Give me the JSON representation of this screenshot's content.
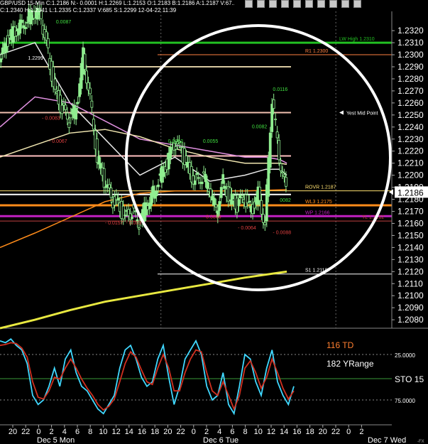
{
  "header": {
    "title": "GBP/USD 15-Min C:1.2186 N:- 0.0001 H:1.2269 L:1.2153 O:1.2183 B:1.2186 A:1.2187 V:67..",
    "line2": "C:1.2340 H:1.2341 L:1.2335 C:1.2337 V:685 S:1.2299 12-04-22 11:39"
  },
  "toolbar_icons": [
    "zoom-icon",
    "zoom-icon",
    "cursor-icon",
    "line-icon",
    "crosshair-icon",
    "text-icon",
    "pin-icon",
    "pencil-icon",
    "fib-icon",
    "magnet-icon"
  ],
  "colors": {
    "background": "#000000",
    "candle": "#90ee90",
    "green_line": "#22c022",
    "magenta_line": "#c020c0",
    "orange_line": "#ff8c1a",
    "yellow_line": "#e8e840",
    "pink_ma": "#e090e0",
    "white_ma": "#e8e8e8",
    "cream_ma": "#f0e6b0",
    "stoch_fast": "#40d8ff",
    "stoch_slow": "#d03020",
    "circle": "#ffffff"
  },
  "price_axis": {
    "labels": [
      "1.2320",
      "1.2310",
      "1.2300",
      "1.2290",
      "1.2280",
      "1.2270",
      "1.2260",
      "1.2250",
      "1.2240",
      "1.2230",
      "1.2220",
      "1.2210",
      "1.2200",
      "1.2190",
      "1.2180",
      "1.2170",
      "1.2160",
      "1.2150",
      "1.2140",
      "1.2130",
      "1.2120",
      "1.2110",
      "1.2100",
      "1.2090",
      "1.2080"
    ],
    "values": [
      1.232,
      1.231,
      1.23,
      1.229,
      1.228,
      1.227,
      1.226,
      1.225,
      1.224,
      1.223,
      1.222,
      1.221,
      1.22,
      1.219,
      1.218,
      1.217,
      1.216,
      1.215,
      1.214,
      1.213,
      1.212,
      1.211,
      1.21,
      1.209,
      1.208
    ],
    "current": "1.2186"
  },
  "levels": [
    {
      "label": "LW High 1.2310",
      "value": 1.231,
      "color": "#22c022",
      "kind": "bold"
    },
    {
      "label": "R1 1.2300",
      "value": 1.23,
      "color": "#ff8040",
      "kind": "thin"
    },
    {
      "label": "ROVR 1.2187",
      "value": 1.2187,
      "color": "#ffe070",
      "kind": "thin"
    },
    {
      "label": "WL3 1.2175",
      "value": 1.2175,
      "color": "#ff8c1a",
      "kind": "bold"
    },
    {
      "label": "WP 1.2166",
      "value": 1.2166,
      "color": "#c020c0",
      "kind": "bold"
    },
    {
      "label": "TL 1.2162",
      "value": 1.2162,
      "color": "#c04040",
      "kind": "thin"
    },
    {
      "label": "S1 1.2118",
      "value": 1.2118,
      "color": "#ffffff",
      "kind": "thin"
    }
  ],
  "annotations": {
    "yest_mid_point": "Yest Mid Point",
    "swing_labels": [
      "0.0087",
      "1.2299",
      "- 0.0083",
      "- 0.0067",
      "0.0052",
      "0.0055",
      "0.0082",
      "0.0116",
      "- 0.0157",
      "- 0.003",
      "- 0.0056",
      "- 0.0064",
      "- 0.0088",
      "0082"
    ]
  },
  "stochastic": {
    "td_label": "116 TD",
    "yrange_label": "182 YRange",
    "name": "STO 15",
    "levels": [
      "25.0000",
      "75.0000"
    ]
  },
  "time_axis": {
    "hours": [
      "20",
      "22",
      "0",
      "2",
      "4",
      "6",
      "8",
      "10",
      "12",
      "14",
      "16",
      "18",
      "20",
      "22",
      "0",
      "2",
      "4",
      "6",
      "8",
      "10",
      "12",
      "14",
      "16",
      "18",
      "20",
      "22",
      "0",
      "2"
    ],
    "days": [
      "Dec 5 Mon",
      "Dec 6 Tue",
      "Dec 7 Wed"
    ],
    "footer_mark": "-FX"
  },
  "chart_data": {
    "type": "line",
    "title": "GBP/USD 15-Min",
    "ylim": [
      1.2073,
      1.2336
    ],
    "xlim_hours_from_dec5_0000": [
      -5,
      51
    ],
    "series": [
      {
        "name": "GBP/USD",
        "x": [
          -5,
          -4,
          -3,
          -2,
          -1,
          0,
          1,
          2,
          3,
          4,
          5,
          6,
          7,
          8,
          9,
          10,
          11,
          12,
          13,
          14,
          15,
          16,
          17,
          18,
          19,
          20,
          21,
          22,
          23,
          24,
          25,
          26,
          27,
          28,
          29,
          30,
          31,
          32,
          33,
          34,
          35,
          36
        ],
        "values": [
          1.229,
          1.231,
          1.2318,
          1.2325,
          1.233,
          1.2336,
          1.233,
          1.23,
          1.2268,
          1.2255,
          1.2245,
          1.2255,
          1.23,
          1.2265,
          1.2215,
          1.2195,
          1.218,
          1.2175,
          1.2165,
          1.217,
          1.216,
          1.2175,
          1.2185,
          1.22,
          1.221,
          1.2225,
          1.222,
          1.2205,
          1.2195,
          1.22,
          1.219,
          1.217,
          1.2195,
          1.218,
          1.2175,
          1.218,
          1.217,
          1.2185,
          1.216,
          1.2265,
          1.2215,
          1.2186
        ]
      },
      {
        "name": "MA-white",
        "x": [
          -5,
          0,
          5,
          10,
          15,
          20,
          25,
          30,
          33,
          35,
          36
        ],
        "values": [
          1.23,
          1.231,
          1.226,
          1.223,
          1.22,
          1.2215,
          1.2195,
          1.22,
          1.2205,
          1.2205,
          1.22
        ]
      },
      {
        "name": "MA-pink",
        "x": [
          -5,
          0,
          5,
          10,
          15,
          20,
          25,
          30,
          33,
          35,
          36
        ],
        "values": [
          1.224,
          1.2265,
          1.226,
          1.2245,
          1.223,
          1.2225,
          1.222,
          1.2215,
          1.2215,
          1.2213,
          1.221
        ]
      },
      {
        "name": "MA-cream",
        "x": [
          -5,
          0,
          5,
          10,
          15,
          20,
          25,
          30,
          33,
          35,
          36
        ],
        "values": [
          1.2215,
          1.2225,
          1.2235,
          1.2238,
          1.2232,
          1.2222,
          1.2215,
          1.221,
          1.221,
          1.221,
          1.2209
        ]
      },
      {
        "name": "MA-orange",
        "x": [
          -5,
          0,
          5,
          10,
          15,
          20,
          25,
          30,
          36
        ],
        "values": [
          1.214,
          1.2152,
          1.2165,
          1.2178,
          1.2185,
          1.2187,
          1.2187,
          1.2187,
          1.2188
        ]
      },
      {
        "name": "MA-yellow",
        "x": [
          -5,
          0,
          5,
          10,
          15,
          20,
          25,
          30,
          36
        ],
        "values": [
          1.2073,
          1.208,
          1.2088,
          1.2095,
          1.21,
          1.2105,
          1.211,
          1.2115,
          1.212
        ]
      }
    ],
    "stoch_series": [
      {
        "name": "fast",
        "values": [
          10,
          12,
          8,
          15,
          20,
          35,
          70,
          80,
          75,
          60,
          40,
          60,
          30,
          20,
          45,
          60,
          65,
          75,
          85,
          90,
          80,
          70,
          40,
          20,
          15,
          30,
          50,
          60,
          55,
          30,
          15,
          50,
          80,
          60,
          30,
          20,
          10,
          25,
          60,
          75,
          70,
          45,
          80,
          90,
          60,
          25,
          30,
          55,
          70,
          40,
          20,
          55,
          70,
          80,
          60
        ]
      },
      {
        "name": "slow",
        "values": [
          15,
          14,
          12,
          13,
          18,
          28,
          55,
          72,
          74,
          65,
          50,
          52,
          40,
          30,
          40,
          52,
          62,
          70,
          80,
          86,
          82,
          74,
          55,
          35,
          22,
          28,
          42,
          55,
          58,
          40,
          25,
          40,
          65,
          65,
          45,
          30,
          20,
          22,
          45,
          65,
          70,
          55,
          70,
          85,
          70,
          40,
          32,
          45,
          62,
          50,
          30,
          45,
          62,
          74,
          65
        ]
      }
    ]
  }
}
